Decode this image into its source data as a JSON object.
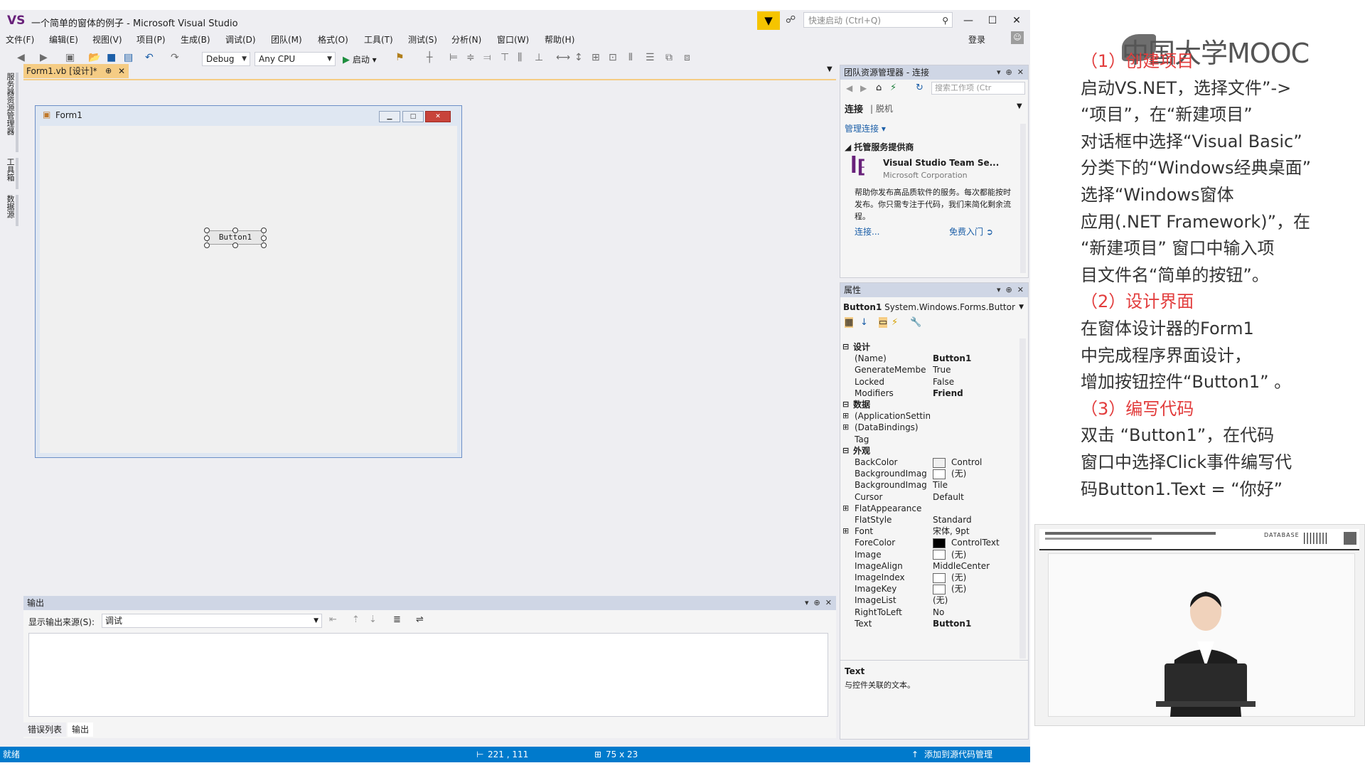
{
  "titlebar": {
    "title": "一个简单的窗体的例子 - Microsoft Visual Studio",
    "logo": "VS",
    "quicklaunch_placeholder": "快速启动 (Ctrl+Q)",
    "min": "—",
    "max": "☐",
    "close": "✕"
  },
  "menu": [
    "文件(F)",
    "编辑(E)",
    "视图(V)",
    "项目(P)",
    "生成(B)",
    "调试(D)",
    "团队(M)",
    "格式(O)",
    "工具(T)",
    "测试(S)",
    "分析(N)",
    "窗口(W)",
    "帮助(H)"
  ],
  "login": "登录",
  "toolbar": {
    "config": "Debug",
    "platform": "Any CPU",
    "start": "启动"
  },
  "leftbar": [
    "服务器资源管理器",
    "工具箱",
    "数据源"
  ],
  "doc_tab": {
    "label": "Form1.vb [设计]*",
    "pin": "⊕",
    "close": "✕"
  },
  "designer": {
    "form_title": "Form1",
    "button_text": "Button1"
  },
  "output": {
    "title": "输出",
    "source_label": "显示输出来源(S):",
    "source_value": "调试",
    "tabs": [
      "错误列表",
      "输出"
    ]
  },
  "statusbar": {
    "status": "就绪",
    "position": "221 , 111",
    "size": "75 x 23",
    "source_control": "添加到源代码管理"
  },
  "team_explorer": {
    "title": "团队资源管理器 - 连接",
    "search_placeholder": "搜索工作项 (Ctr",
    "connect_tab": "连接",
    "offline_tab": "脱机",
    "manage": "管理连接",
    "hosted_header": "托管服务提供商",
    "service_name": "Visual Studio Team Se...",
    "service_vendor": "Microsoft Corporation",
    "service_desc": "帮助你发布高品质软件的服务。每次都能按时发布。你只需专注于代码，我们来简化剩余流程。",
    "connect_link": "连接...",
    "free_link": "免费入门"
  },
  "properties": {
    "title": "属性",
    "object": "Button1",
    "object_type": "System.Windows.Forms.Buttor",
    "rows": [
      {
        "name": "设计",
        "value": "",
        "cat": true,
        "exp": "⊟"
      },
      {
        "name": "(Name)",
        "value": "Button1",
        "bold": true
      },
      {
        "name": "GenerateMembe",
        "value": "True"
      },
      {
        "name": "Locked",
        "value": "False"
      },
      {
        "name": "Modifiers",
        "value": "Friend",
        "bold": true
      },
      {
        "name": "数据",
        "value": "",
        "cat": true,
        "exp": "⊟"
      },
      {
        "name": "(ApplicationSettin",
        "value": "",
        "exp": "⊞"
      },
      {
        "name": "(DataBindings)",
        "value": "",
        "exp": "⊞"
      },
      {
        "name": "Tag",
        "value": ""
      },
      {
        "name": "外观",
        "value": "",
        "cat": true,
        "exp": "⊟"
      },
      {
        "name": "BackColor",
        "value": "Control",
        "swatch": "#f0f0f0"
      },
      {
        "name": "BackgroundImag",
        "value": "(无)",
        "swatch": "#ffffff"
      },
      {
        "name": "BackgroundImag",
        "value": "Tile"
      },
      {
        "name": "Cursor",
        "value": "Default"
      },
      {
        "name": "FlatAppearance",
        "value": "",
        "exp": "⊞"
      },
      {
        "name": "FlatStyle",
        "value": "Standard"
      },
      {
        "name": "Font",
        "value": "宋体, 9pt",
        "exp": "⊞"
      },
      {
        "name": "ForeColor",
        "value": "ControlText",
        "swatch": "#000000"
      },
      {
        "name": "Image",
        "value": "(无)",
        "swatch": "#ffffff"
      },
      {
        "name": "ImageAlign",
        "value": "MiddleCenter"
      },
      {
        "name": "ImageIndex",
        "value": "(无)",
        "swatch": "#ffffff"
      },
      {
        "name": "ImageKey",
        "value": "(无)",
        "swatch": "#ffffff"
      },
      {
        "name": "ImageList",
        "value": "(无)"
      },
      {
        "name": "RightToLeft",
        "value": "No"
      },
      {
        "name": "Text",
        "value": "Button1",
        "bold": true
      }
    ],
    "desc_title": "Text",
    "desc_text": "与控件关联的文本。"
  },
  "lecture": {
    "logo": "中国大学MOOC",
    "lines": [
      {
        "text": "（1）创建项目",
        "red": true
      },
      {
        "text": "启动VS.NET，选择文件”->"
      },
      {
        "text": "“项目”，在“新建项目”"
      },
      {
        "text": "对话框中选择“Visual  Basic”"
      },
      {
        "text": "分类下的“Windows经典桌面”"
      },
      {
        "text": "选择“Windows窗体"
      },
      {
        "text": "应用(.NET Framework)”，在"
      },
      {
        "text": "“新建项目” 窗口中输入项"
      },
      {
        "text": "目文件名“简单的按钮”。"
      },
      {
        "text": "（2）设计界面",
        "red": true
      },
      {
        "text": "在窗体设计器的Form1"
      },
      {
        "text": "中完成程序界面设计，"
      },
      {
        "text": "增加按钮控件“Button1” 。"
      },
      {
        "text": "（3）编写代码",
        "red": true
      },
      {
        "text": "双击 “Button1”，在代码"
      },
      {
        "text": "窗口中选择Click事件编写代"
      },
      {
        "text": "码Button1.Text = “你好”"
      }
    ],
    "video_banner": "DATABASE"
  },
  "colors": {
    "accent": "#007acc",
    "tab_active": "#f5cc84",
    "lecture_red": "#e23c3c"
  }
}
